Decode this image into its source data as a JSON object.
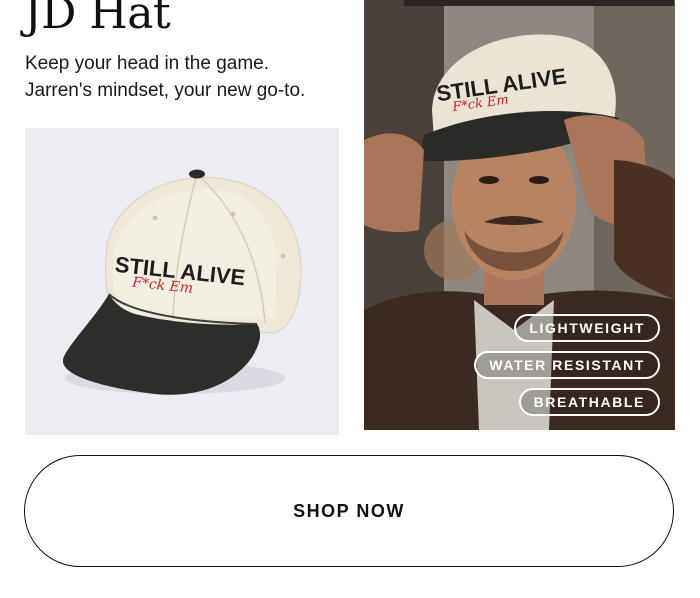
{
  "product": {
    "title": "JD Hat",
    "tagline_line1": "Keep your head in the game.",
    "tagline_line2": "Jarren's mindset, your new go-to.",
    "hat_text_main": "STILL ALIVE",
    "hat_text_script": "F*ck Em"
  },
  "features": [
    "LIGHTWEIGHT",
    "WATER RESISTANT",
    "BREATHABLE"
  ],
  "cta": {
    "label": "SHOP NOW"
  },
  "colors": {
    "hat_crown": "#eee6d6",
    "hat_brim": "#2a2c29",
    "hat_script": "#c8232b",
    "product_bg": "#ecedf3"
  }
}
